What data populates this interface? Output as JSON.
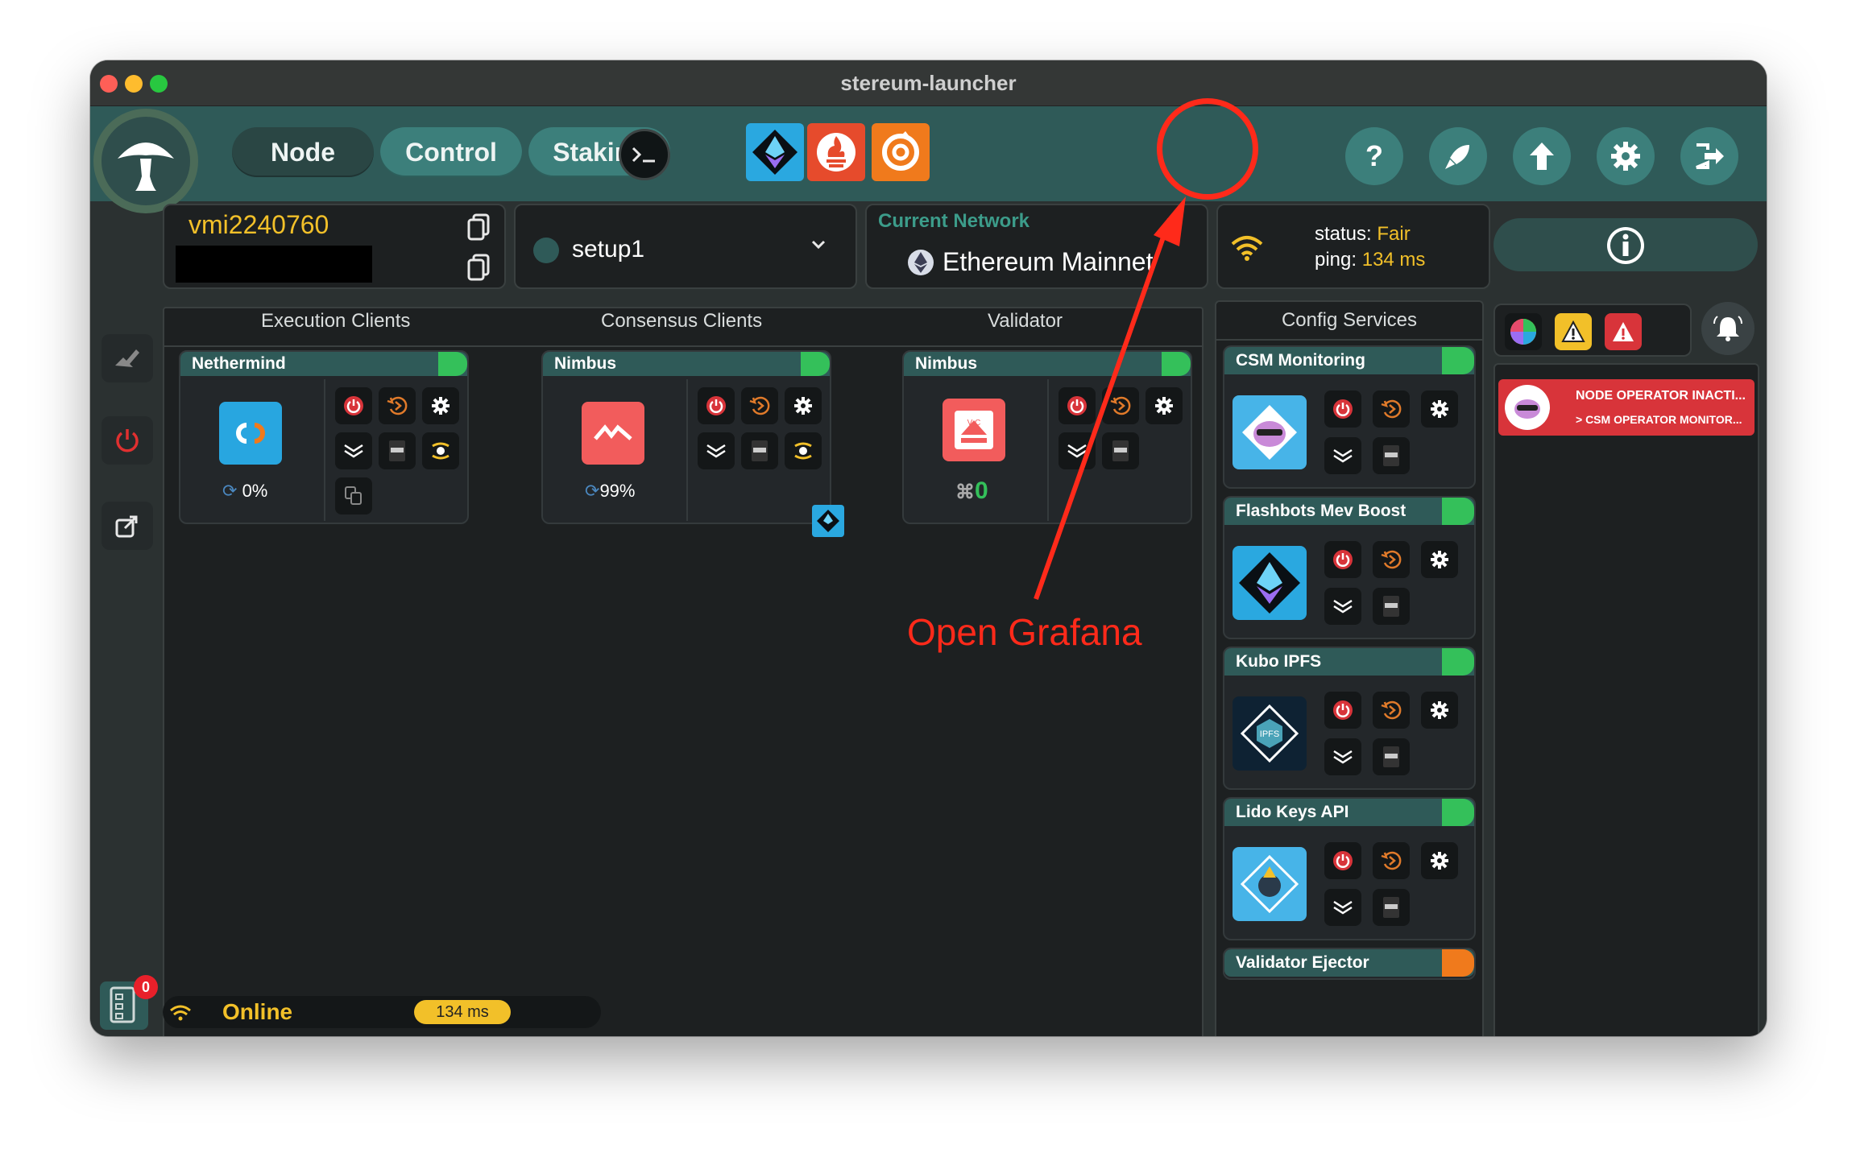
{
  "window": {
    "title": "stereum-launcher"
  },
  "nav": {
    "node": "Node",
    "control": "Control",
    "staking": "Staking"
  },
  "server": {
    "name": "vmi2240760"
  },
  "setup": {
    "name": "setup1"
  },
  "network": {
    "label": "Current Network",
    "name": "Ethereum Mainnet"
  },
  "connection": {
    "status_label": "status:",
    "status_value": "Fair",
    "ping_label": "ping:",
    "ping_value": "134 ms"
  },
  "columns": {
    "execution": "Execution Clients",
    "consensus": "Consensus Clients",
    "validator": "Validator"
  },
  "clients": [
    {
      "name": "Nethermind",
      "sync": "0%"
    },
    {
      "name": "Nimbus",
      "sync": "99%"
    },
    {
      "name": "Nimbus",
      "keys": "0"
    }
  ],
  "config_services": {
    "title": "Config Services",
    "items": [
      "CSM Monitoring",
      "Flashbots Mev Boost",
      "Kubo IPFS",
      "Lido Keys API",
      "Validator Ejector"
    ]
  },
  "notification": {
    "title": "NODE OPERATOR INACTI...",
    "subtitle": "> CSM OPERATOR MONITOR..."
  },
  "footer": {
    "status": "Online",
    "ping": "134 ms",
    "badge_count": "0"
  },
  "annotation": {
    "text": "Open Grafana",
    "color": "#ff2a1a"
  },
  "colors": {
    "accent_teal": "#2f5a58",
    "button_teal": "#3c7f7b",
    "toggle_green": "#34c05a",
    "warning_orange": "#f07a1c",
    "alert_red": "#d8343a",
    "highlight_yellow": "#f2c029"
  },
  "icons": [
    "mushroom-logo-icon",
    "terminal-icon",
    "ethereum-service-icon",
    "prometheus-icon",
    "grafana-icon",
    "help-icon",
    "rocket-icon",
    "update-icon",
    "settings-icon",
    "logout-icon",
    "copy-icon",
    "power-icon",
    "restart-icon",
    "gear-icon",
    "logs-icon",
    "doc-icon",
    "info-icon",
    "bell-icon",
    "wifi-icon",
    "key-icon"
  ]
}
